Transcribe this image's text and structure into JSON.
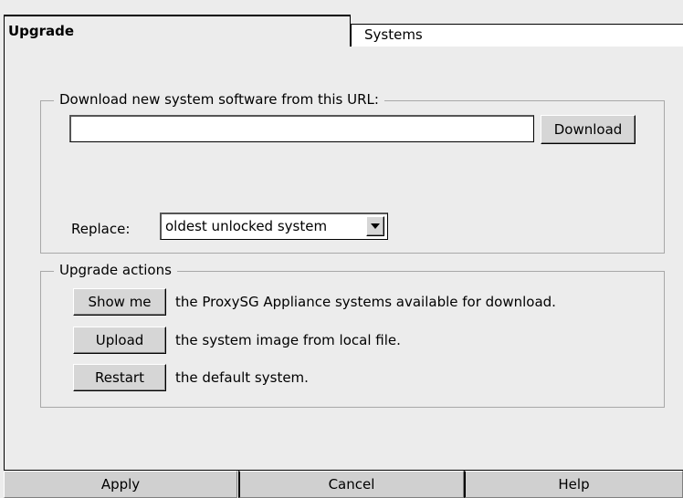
{
  "tabs": [
    {
      "label": "Upgrade",
      "active": true
    },
    {
      "label": "Systems",
      "active": false
    }
  ],
  "download_group": {
    "legend": "Download new system software from this URL:",
    "url_value": "",
    "download_button": "Download",
    "replace_label": "Replace:",
    "replace_selected": "oldest unlocked system"
  },
  "actions_group": {
    "legend": "Upgrade actions",
    "actions": [
      {
        "button": "Show me",
        "text": "the ProxySG Appliance systems available for download."
      },
      {
        "button": "Upload",
        "text": "the system image from local file."
      },
      {
        "button": "Restart",
        "text": "the default system."
      }
    ]
  },
  "bottom_buttons": {
    "apply": "Apply",
    "cancel": "Cancel",
    "help": "Help"
  },
  "icons": {
    "select_arrow": "chevron-down-icon"
  }
}
